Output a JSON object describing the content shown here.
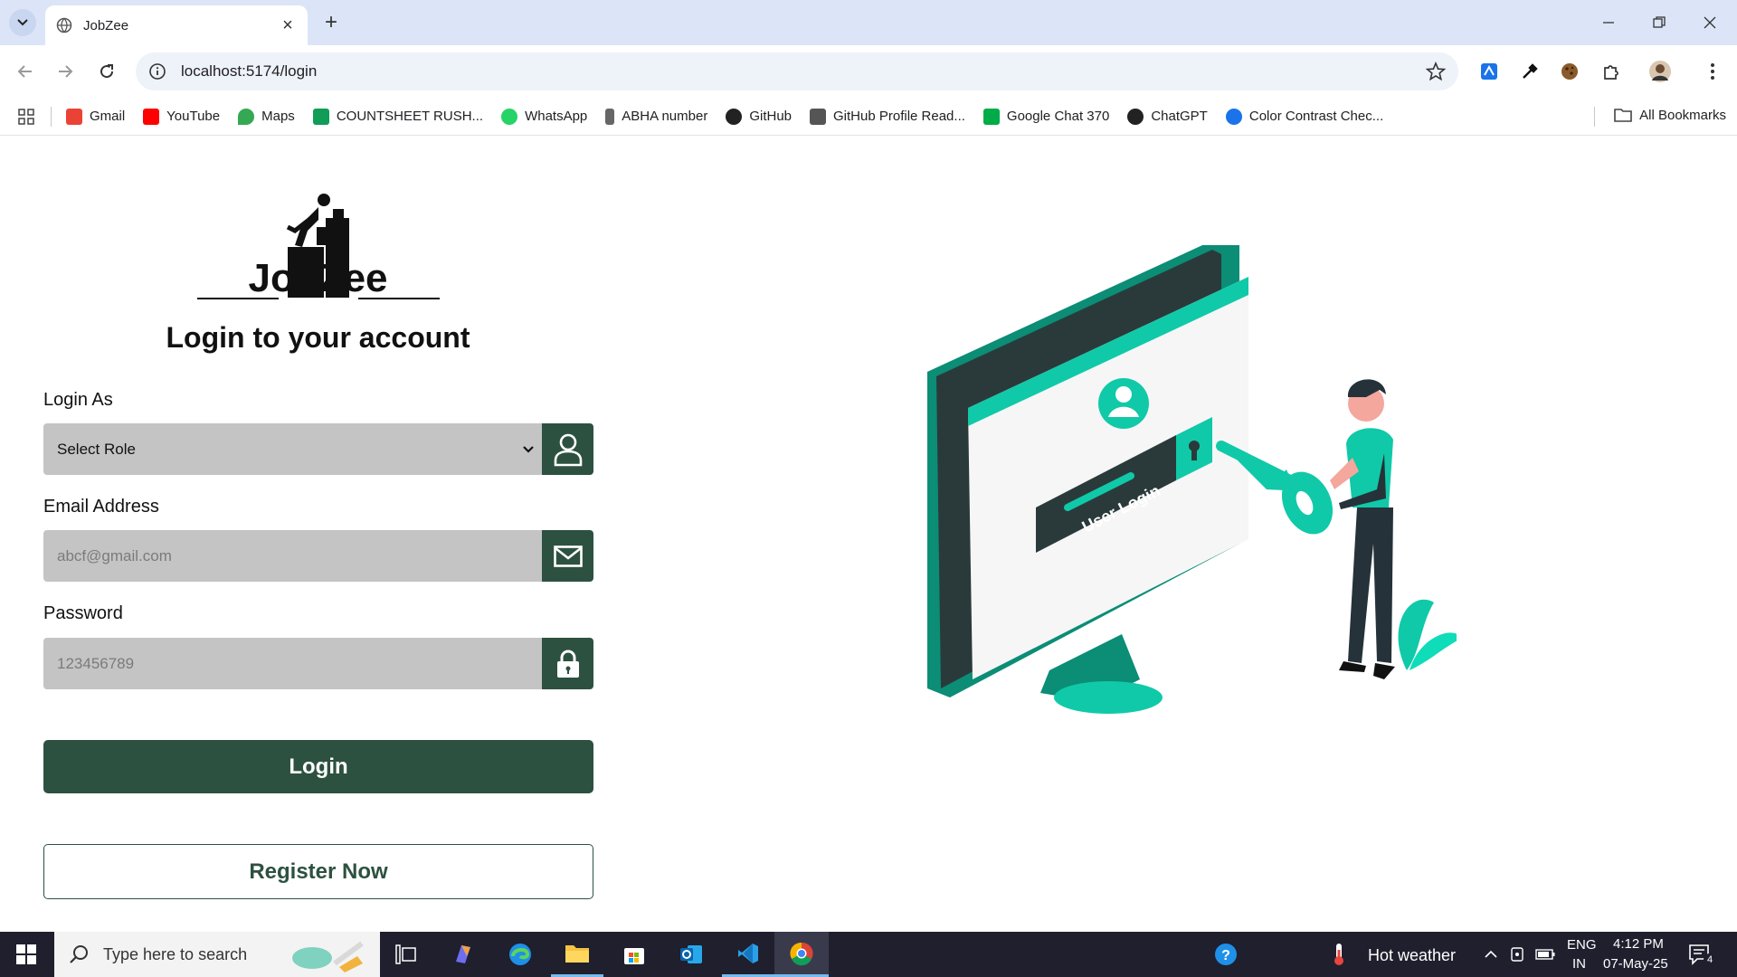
{
  "browser": {
    "tab_title": "JobZee",
    "url": "localhost:5174/login",
    "bookmarks": [
      {
        "label": "Gmail",
        "color": "#ea4335"
      },
      {
        "label": "YouTube",
        "color": "#ff0000"
      },
      {
        "label": "Maps",
        "color": "#34a853"
      },
      {
        "label": "COUNTSHEET RUSH...",
        "color": "#0f9d58"
      },
      {
        "label": "WhatsApp",
        "color": "#25d366"
      },
      {
        "label": "ABHA number",
        "color": "#666666"
      },
      {
        "label": "GitHub",
        "color": "#222222"
      },
      {
        "label": "GitHub Profile Read...",
        "color": "#555555"
      },
      {
        "label": "Google Chat 370",
        "color": "#00ac47"
      },
      {
        "label": "ChatGPT",
        "color": "#222222"
      },
      {
        "label": "Color Contrast Chec...",
        "color": "#1a73e8"
      }
    ],
    "all_bookmarks": "All Bookmarks"
  },
  "page": {
    "brand": "JobZee",
    "title": "Login to your account",
    "role_label": "Login As",
    "role_value": "Select Role",
    "email_label": "Email Address",
    "email_placeholder": "abcf@gmail.com",
    "password_label": "Password",
    "password_placeholder": "123456789",
    "login_button": "Login",
    "register_button": "Register Now",
    "illustration_text": "User Login",
    "accent_color": "#2d5140",
    "illustration_color": "#10c9a8"
  },
  "taskbar": {
    "search_placeholder": "Type here to search",
    "weather": "Hot weather",
    "lang_top": "ENG",
    "lang_bottom": "IN",
    "time": "4:12 PM",
    "date": "07-May-25",
    "notification_count": "4"
  }
}
